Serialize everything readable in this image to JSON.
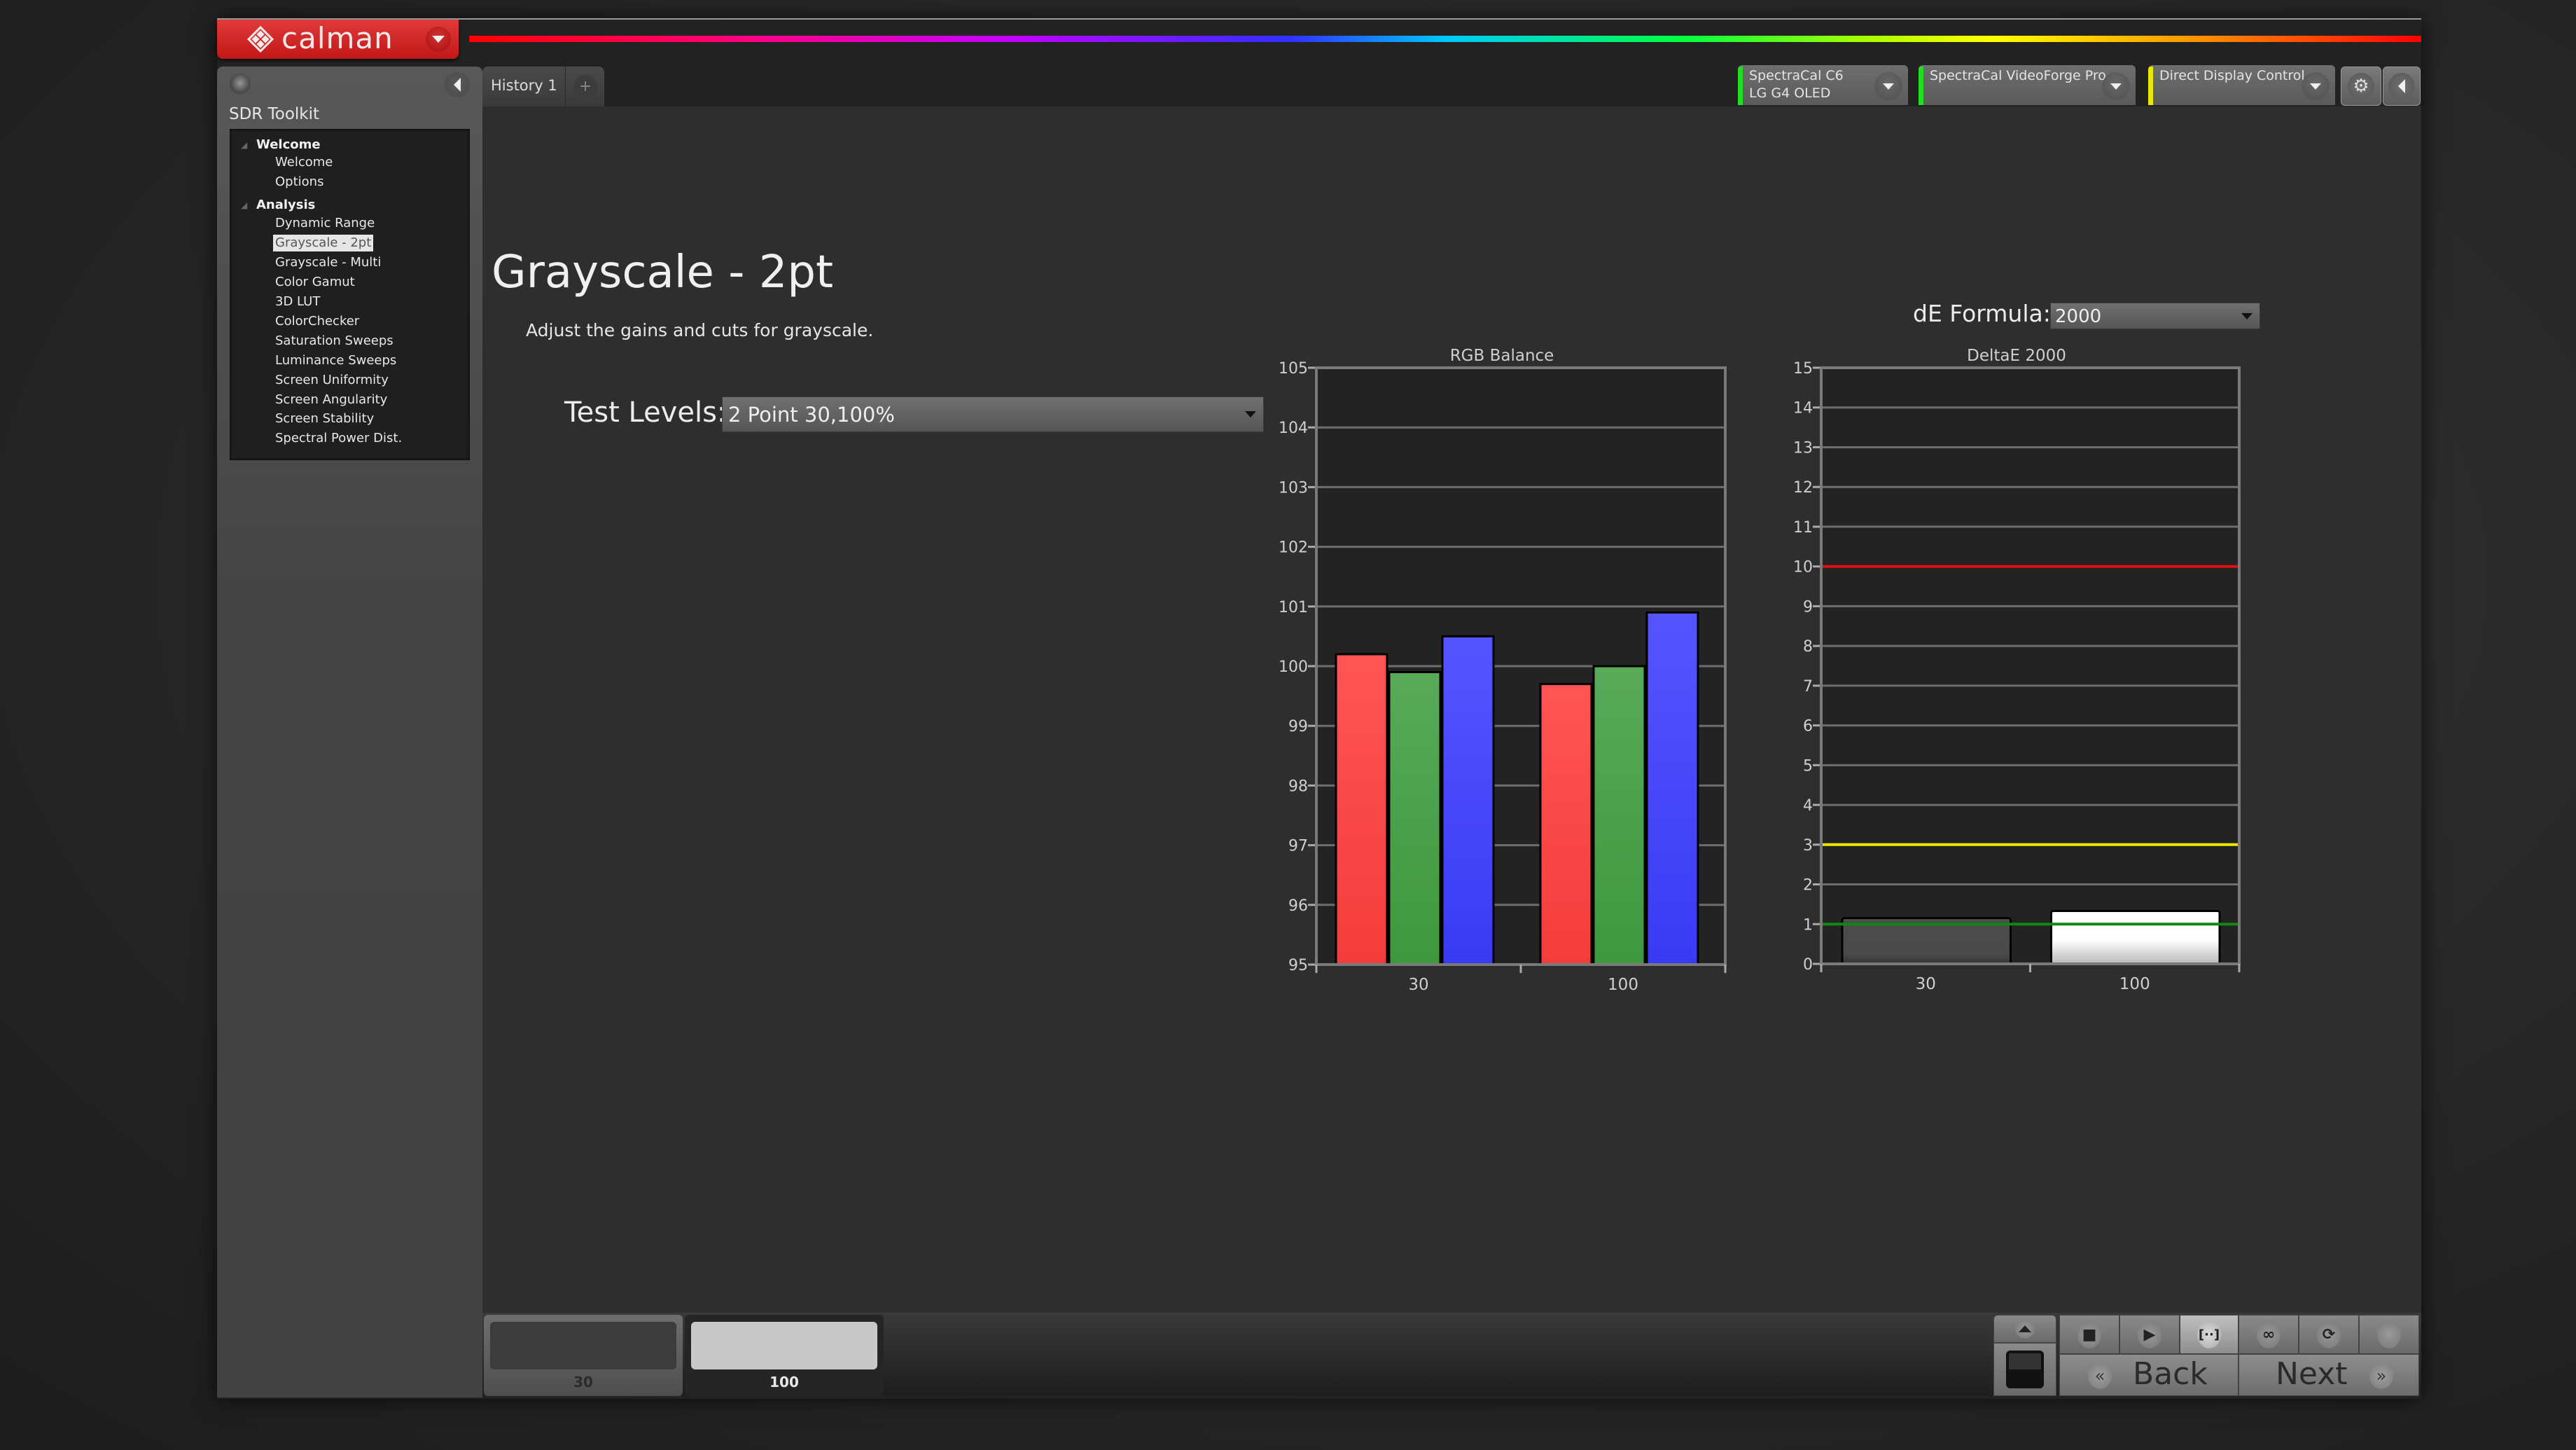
{
  "app": {
    "logo_text": "calman",
    "tab": {
      "label": "History 1",
      "add_label": "+"
    }
  },
  "sidebar": {
    "title": "SDR Toolkit",
    "groups": [
      {
        "label": "Welcome",
        "items": [
          "Welcome",
          "Options"
        ]
      },
      {
        "label": "Analysis",
        "items": [
          "Dynamic Range",
          "Grayscale - 2pt",
          "Grayscale - Multi",
          "Color Gamut",
          "3D LUT",
          "ColorChecker",
          "Saturation Sweeps",
          "Luminance Sweeps",
          "Screen Uniformity",
          "Screen Angularity",
          "Screen Stability",
          "Spectral Power Dist."
        ]
      }
    ],
    "selected_item": "Grayscale - 2pt"
  },
  "devices": [
    {
      "line1": "SpectraCal C6",
      "line2": "LG G4 OLED",
      "status_color": "#22dd22"
    },
    {
      "line1": "SpectraCal VideoForge Pro",
      "line2": "",
      "status_color": "#22dd22"
    },
    {
      "line1": "Direct Display Control",
      "line2": "",
      "status_color": "#e8e800"
    }
  ],
  "toolbar": {
    "settings_icon": "gear-icon",
    "collapse_icon": "chevron-left-icon"
  },
  "page": {
    "title": "Grayscale - 2pt",
    "subtitle": "Adjust the gains and cuts for grayscale.",
    "test_levels_label": "Test Levels:",
    "test_levels_value": "2 Point 30,100%",
    "de_formula_label": "dE Formula:",
    "de_formula_value": "2000"
  },
  "chart_data": [
    {
      "type": "bar",
      "title": "RGB Balance",
      "categories": [
        "30",
        "100"
      ],
      "series": [
        {
          "name": "Red",
          "color": "#ff5050",
          "values": [
            100.2,
            99.7
          ]
        },
        {
          "name": "Green",
          "color": "#52a852",
          "values": [
            99.9,
            100.0
          ]
        },
        {
          "name": "Blue",
          "color": "#5050ff",
          "values": [
            100.5,
            100.9
          ]
        }
      ],
      "ylim": [
        95,
        105
      ],
      "yticks": [
        95,
        96,
        97,
        98,
        99,
        100,
        101,
        102,
        103,
        104,
        105
      ],
      "xlabel": "",
      "ylabel": "",
      "grid": true,
      "legend": "none"
    },
    {
      "type": "bar",
      "title": "DeltaE 2000",
      "categories": [
        "30",
        "100"
      ],
      "series": [
        {
          "name": "dE2000",
          "values": [
            1.15,
            1.33
          ],
          "colors": [
            "#4a4a4a",
            "#ffffff"
          ]
        }
      ],
      "reference_lines": [
        {
          "value": 10,
          "color": "#dd1111"
        },
        {
          "value": 3,
          "color": "#e8e800"
        },
        {
          "value": 1,
          "color": "#118811"
        }
      ],
      "ylim": [
        0,
        15
      ],
      "yticks": [
        0,
        1,
        2,
        3,
        4,
        5,
        6,
        7,
        8,
        9,
        10,
        11,
        12,
        13,
        14,
        15
      ],
      "xlabel": "",
      "ylabel": "",
      "grid": true,
      "legend": "none"
    }
  ],
  "patches": [
    {
      "label": "30",
      "swatch_color": "#3c3c3c",
      "selected": true
    },
    {
      "label": "100",
      "swatch_color": "#c8c8c8",
      "selected": false
    }
  ],
  "controls": {
    "buttons": [
      "stop",
      "play",
      "read-continuous",
      "loop",
      "refresh",
      "blank"
    ],
    "back_label": "Back",
    "next_label": "Next"
  }
}
